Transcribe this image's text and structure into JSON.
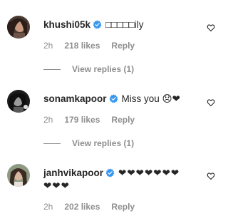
{
  "comments": [
    {
      "username": "khushi05k",
      "text": "□□□□□ily",
      "time": "2h",
      "likes": "218 likes",
      "reply": "Reply",
      "view_replies": "View replies (1)"
    },
    {
      "username": "sonamkapoor",
      "text": "Miss you 😞❤",
      "time": "2h",
      "likes": "179 likes",
      "reply": "Reply",
      "view_replies": "View replies (1)"
    },
    {
      "username": "janhvikapoor",
      "text": "❤❤❤❤❤❤❤",
      "text_line2": "❤❤❤",
      "time": "2h",
      "likes": "202 likes",
      "reply": "Reply"
    }
  ],
  "colors": {
    "verified": "#3897f0",
    "muted": "#8e8e8e",
    "text": "#262626"
  },
  "icons": {
    "verified": "verified-badge-icon",
    "like": "heart-outline-icon"
  }
}
